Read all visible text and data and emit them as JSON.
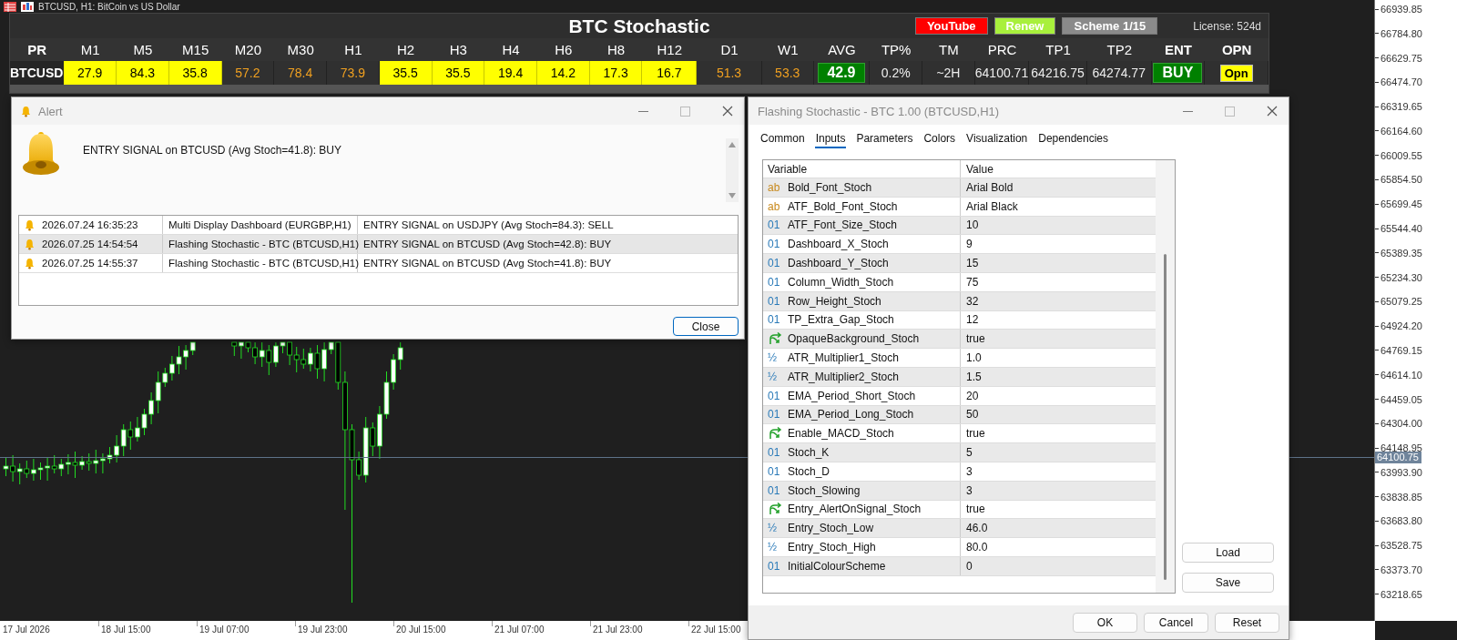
{
  "chart": {
    "title": "BTCUSD, H1:  BitCoin vs US Dollar",
    "price_labels": [
      "66939.85",
      "66784.80",
      "66629.75",
      "66474.70",
      "66319.65",
      "66164.60",
      "66009.55",
      "65854.50",
      "65699.45",
      "65544.40",
      "65389.35",
      "65234.30",
      "65079.25",
      "64924.20",
      "64769.15",
      "64614.10",
      "64459.05",
      "64304.00",
      "64148.95",
      "63993.90",
      "63838.85",
      "63683.80",
      "63528.75",
      "63373.70",
      "63218.65"
    ],
    "current_price": "64100.75",
    "time_labels": [
      "17 Jul 2026",
      "18 Jul 15:00",
      "19 Jul 07:00",
      "19 Jul 23:00",
      "20 Jul 15:00",
      "21 Jul 07:00",
      "21 Jul 23:00",
      "22 Jul 15:00"
    ]
  },
  "dashboard": {
    "title": "BTC Stochastic",
    "buttons": [
      {
        "label": "YouTube",
        "color": "#ff0000"
      },
      {
        "label": "Renew",
        "color": "#a8f03c"
      },
      {
        "label": "Scheme 1/15",
        "color": "#8a8a8a"
      }
    ],
    "license": "License: 524d",
    "columns": [
      {
        "label": "PR",
        "bold": true
      },
      {
        "label": "M1",
        "bold": false
      },
      {
        "label": "M5",
        "bold": false
      },
      {
        "label": "M15",
        "bold": false
      },
      {
        "label": "M20",
        "bold": false
      },
      {
        "label": "M30",
        "bold": false
      },
      {
        "label": "H1",
        "bold": false
      },
      {
        "label": "H2",
        "bold": false
      },
      {
        "label": "H3",
        "bold": false
      },
      {
        "label": "H4",
        "bold": false
      },
      {
        "label": "H6",
        "bold": false
      },
      {
        "label": "H8",
        "bold": false
      },
      {
        "label": "H12",
        "bold": false
      },
      {
        "label": "D1",
        "bold": false
      },
      {
        "label": "W1",
        "bold": false
      },
      {
        "label": "AVG",
        "bold": false
      },
      {
        "label": "TP%",
        "bold": false
      },
      {
        "label": "TM",
        "bold": false
      },
      {
        "label": "PRC",
        "bold": false
      },
      {
        "label": "TP1",
        "bold": false
      },
      {
        "label": "TP2",
        "bold": false
      },
      {
        "label": "ENT",
        "bold": true
      },
      {
        "label": "OPN",
        "bold": true
      }
    ],
    "rows": [
      {
        "cells": [
          {
            "kind": "pair",
            "text": "BTCUSD"
          },
          {
            "kind": "stoch",
            "text": "27.9",
            "highlighted": true
          },
          {
            "kind": "stoch",
            "text": "84.3",
            "highlighted": true
          },
          {
            "kind": "stoch",
            "text": "35.8",
            "highlighted": true
          },
          {
            "kind": "stoch",
            "text": "57.2",
            "highlighted": false
          },
          {
            "kind": "stoch",
            "text": "78.4",
            "highlighted": false
          },
          {
            "kind": "stoch",
            "text": "73.9",
            "highlighted": false
          },
          {
            "kind": "stoch",
            "text": "35.5",
            "highlighted": true
          },
          {
            "kind": "stoch",
            "text": "35.5",
            "highlighted": true
          },
          {
            "kind": "stoch",
            "text": "19.4",
            "highlighted": true
          },
          {
            "kind": "stoch",
            "text": "14.2",
            "highlighted": true
          },
          {
            "kind": "stoch",
            "text": "17.3",
            "highlighted": true
          },
          {
            "kind": "stoch",
            "text": "16.7",
            "highlighted": true
          },
          {
            "kind": "stoch",
            "text": "51.3",
            "highlighted": false
          },
          {
            "kind": "stoch",
            "text": "53.3",
            "highlighted": false
          },
          {
            "kind": "avg",
            "text": "42.9"
          },
          {
            "kind": "text",
            "text": "0.2%"
          },
          {
            "kind": "text",
            "text": "~2H"
          },
          {
            "kind": "text",
            "text": "64100.71"
          },
          {
            "kind": "text",
            "text": "64216.75"
          },
          {
            "kind": "text",
            "text": "64274.77"
          },
          {
            "kind": "signal",
            "text": "BUY"
          },
          {
            "kind": "button",
            "text": "Opn"
          }
        ]
      }
    ]
  },
  "alert": {
    "title": "Alert",
    "message": "ENTRY SIGNAL on BTCUSD (Avg Stoch=41.8): BUY",
    "rows": [
      {
        "time": "2026.07.24 16:35:23",
        "source": "Multi Display Dashboard (EURGBP,H1)",
        "message": "ENTRY SIGNAL on USDJPY (Avg Stoch=84.3): SELL",
        "selected": false
      },
      {
        "time": "2026.07.25 14:54:54",
        "source": "Flashing Stochastic - BTC (BTCUSD,H1)",
        "message": "ENTRY SIGNAL on BTCUSD (Avg Stoch=42.8): BUY",
        "selected": true
      },
      {
        "time": "2026.07.25 14:55:37",
        "source": "Flashing Stochastic - BTC (BTCUSD,H1)",
        "message": "ENTRY SIGNAL on BTCUSD (Avg Stoch=41.8): BUY",
        "selected": false
      }
    ],
    "button": "Close"
  },
  "dialog": {
    "title": "Flashing Stochastic - BTC 1.00 (BTCUSD,H1)",
    "tabs": [
      {
        "label": "Common",
        "selected": false
      },
      {
        "label": "Inputs",
        "selected": true
      },
      {
        "label": "Parameters",
        "selected": false
      },
      {
        "label": "Colors",
        "selected": false
      },
      {
        "label": "Visualization",
        "selected": false
      },
      {
        "label": "Dependencies",
        "selected": false
      }
    ],
    "columns": [
      "Variable",
      "Value"
    ],
    "rows": [
      {
        "kind": "string",
        "icon": "ab",
        "name": "Bold_Font_Stoch",
        "value": "Arial Bold"
      },
      {
        "kind": "string",
        "icon": "ab",
        "name": "ATF_Bold_Font_Stoch",
        "value": "Arial Black"
      },
      {
        "kind": "int",
        "icon": "01",
        "name": "ATF_Font_Size_Stoch",
        "value": "10"
      },
      {
        "kind": "int",
        "icon": "01",
        "name": "Dashboard_X_Stoch",
        "value": "9"
      },
      {
        "kind": "int",
        "icon": "01",
        "name": "Dashboard_Y_Stoch",
        "value": "15"
      },
      {
        "kind": "int",
        "icon": "01",
        "name": "Column_Width_Stoch",
        "value": "75"
      },
      {
        "kind": "int",
        "icon": "01",
        "name": "Row_Height_Stoch",
        "value": "32"
      },
      {
        "kind": "int",
        "icon": "01",
        "name": "TP_Extra_Gap_Stoch",
        "value": "12"
      },
      {
        "kind": "bool",
        "name": "OpaqueBackground_Stoch",
        "value": "true"
      },
      {
        "kind": "double",
        "icon": "½",
        "name": "ATR_Multiplier1_Stoch",
        "value": "1.0"
      },
      {
        "kind": "double",
        "icon": "½",
        "name": "ATR_Multiplier2_Stoch",
        "value": "1.5"
      },
      {
        "kind": "int",
        "icon": "01",
        "name": "EMA_Period_Short_Stoch",
        "value": "20"
      },
      {
        "kind": "int",
        "icon": "01",
        "name": "EMA_Period_Long_Stoch",
        "value": "50"
      },
      {
        "kind": "bool",
        "name": "Enable_MACD_Stoch",
        "value": "true"
      },
      {
        "kind": "int",
        "icon": "01",
        "name": "Stoch_K",
        "value": "5"
      },
      {
        "kind": "int",
        "icon": "01",
        "name": "Stoch_D",
        "value": "3"
      },
      {
        "kind": "int",
        "icon": "01",
        "name": "Stoch_Slowing",
        "value": "3"
      },
      {
        "kind": "bool",
        "name": "Entry_AlertOnSignal_Stoch",
        "value": "true"
      },
      {
        "kind": "double",
        "icon": "½",
        "name": "Entry_Stoch_Low",
        "value": "46.0"
      },
      {
        "kind": "double",
        "icon": "½",
        "name": "Entry_Stoch_High",
        "value": "80.0"
      },
      {
        "kind": "int",
        "icon": "01",
        "name": "InitialColourScheme",
        "value": "0"
      }
    ],
    "side_buttons": [
      "Load",
      "Save"
    ],
    "buttons": [
      "OK",
      "Cancel",
      "Reset"
    ]
  }
}
